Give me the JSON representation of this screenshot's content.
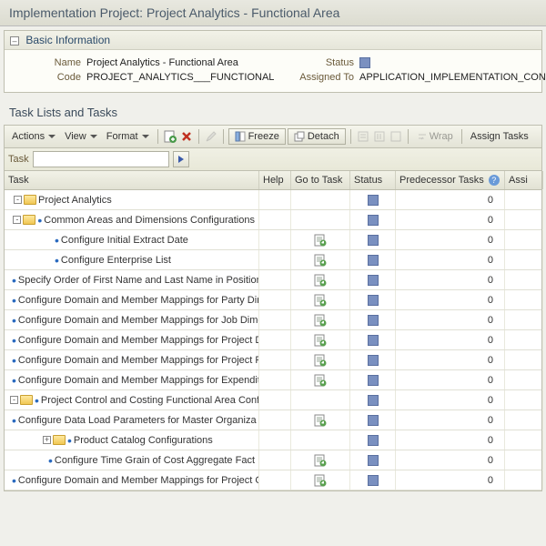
{
  "page_title": "Implementation Project: Project Analytics - Functional Area",
  "basic_info": {
    "header": "Basic Information",
    "name_label": "Name",
    "name_value": "Project Analytics - Functional Area",
    "code_label": "Code",
    "code_value": "PROJECT_ANALYTICS___FUNCTIONAL",
    "status_label": "Status",
    "assigned_label": "Assigned To",
    "assigned_value": "APPLICATION_IMPLEMENTATION_CONSULTANT"
  },
  "task_section": {
    "header": "Task Lists and Tasks",
    "toolbar": {
      "actions": "Actions",
      "view": "View",
      "format": "Format",
      "freeze": "Freeze",
      "detach": "Detach",
      "wrap": "Wrap",
      "assign": "Assign Tasks"
    },
    "filter": {
      "label": "Task",
      "value": ""
    },
    "columns": {
      "task": "Task",
      "help": "Help",
      "goto": "Go to Task",
      "status": "Status",
      "predecessor": "Predecessor Tasks",
      "assigned": "Assi"
    },
    "rows": [
      {
        "label": "Project Analytics",
        "depth": 0,
        "folder": true,
        "exp": "-",
        "goto": false,
        "pred": "0"
      },
      {
        "label": "Common Areas and Dimensions Configurations",
        "depth": 1,
        "folder": true,
        "exp": "-",
        "bullet": true,
        "goto": false,
        "pred": "0"
      },
      {
        "label": "Configure Initial Extract Date",
        "depth": 2,
        "folder": false,
        "bullet": true,
        "goto": true,
        "pred": "0"
      },
      {
        "label": "Configure Enterprise List",
        "depth": 2,
        "folder": false,
        "bullet": true,
        "goto": true,
        "pred": "0"
      },
      {
        "label": "Specify Order of First Name and Last Name in Position Hi",
        "depth": 2,
        "folder": false,
        "bullet": true,
        "goto": true,
        "pred": "0"
      },
      {
        "label": "Configure Domain and Member Mappings for Party Dimer",
        "depth": 2,
        "folder": false,
        "bullet": true,
        "goto": true,
        "pred": "0"
      },
      {
        "label": "Configure Domain and Member Mappings for Job Dimensi",
        "depth": 2,
        "folder": false,
        "bullet": true,
        "goto": true,
        "pred": "0"
      },
      {
        "label": "Configure Domain and Member Mappings for Project Dime",
        "depth": 2,
        "folder": false,
        "bullet": true,
        "goto": true,
        "pred": "0"
      },
      {
        "label": "Configure Domain and Member Mappings for Project Resi",
        "depth": 2,
        "folder": false,
        "bullet": true,
        "goto": true,
        "pred": "0"
      },
      {
        "label": "Configure Domain and Member Mappings for Expenditure",
        "depth": 2,
        "folder": false,
        "bullet": true,
        "goto": true,
        "pred": "0"
      },
      {
        "label": "Project Control and Costing Functional Area Configur",
        "depth": 1,
        "folder": true,
        "exp": "-",
        "bullet": true,
        "goto": false,
        "pred": "0"
      },
      {
        "label": "Configure Data Load Parameters for Master Organiza",
        "depth": 2,
        "folder": false,
        "bullet": true,
        "goto": true,
        "pred": "0"
      },
      {
        "label": "Product Catalog Configurations",
        "depth": 2,
        "folder": true,
        "exp": "+",
        "bullet": true,
        "goto": false,
        "pred": "0"
      },
      {
        "label": "Configure Time Grain of Cost Aggregate Fact",
        "depth": 2,
        "folder": false,
        "bullet": true,
        "goto": true,
        "pred": "0"
      },
      {
        "label": "Configure Domain and Member Mappings for Project C",
        "depth": 2,
        "folder": false,
        "bullet": true,
        "goto": true,
        "pred": "0"
      }
    ]
  }
}
